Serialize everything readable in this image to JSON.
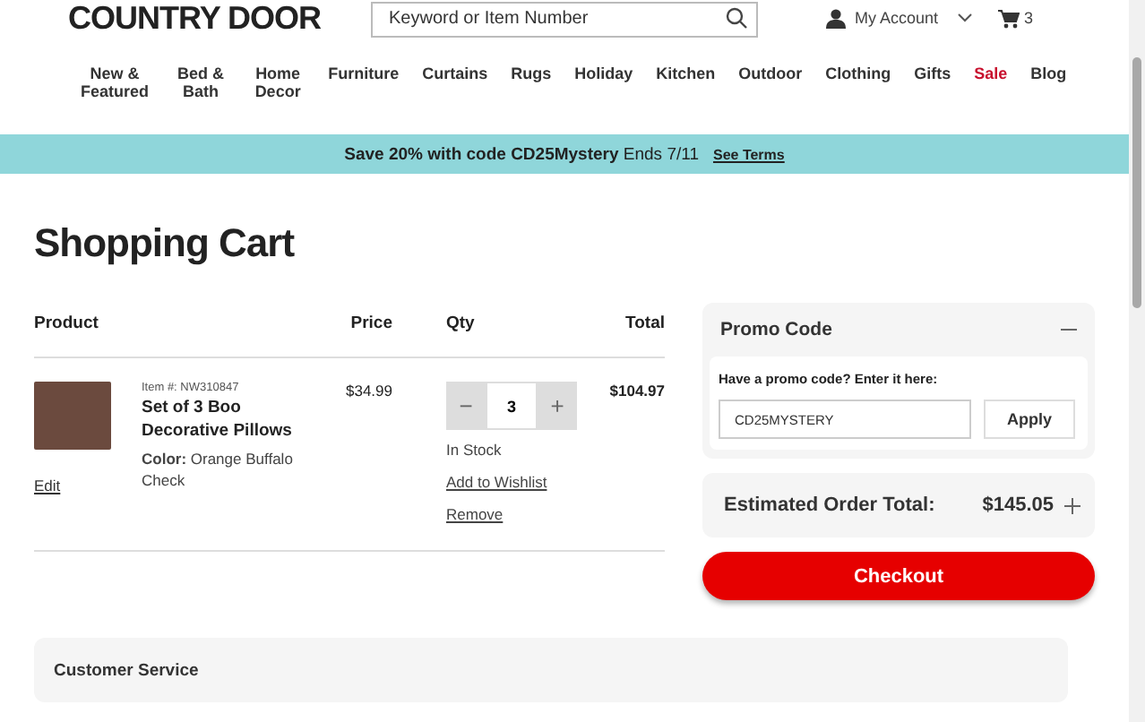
{
  "header": {
    "logo": "COUNTRY DOOR",
    "search": {
      "placeholder": "Keyword or Item Number"
    },
    "account": "My Account",
    "cart_count": "3"
  },
  "nav": [
    {
      "label": "New & Featured",
      "kind": "normal"
    },
    {
      "label": "Bed & Bath",
      "kind": "normal"
    },
    {
      "label": "Home Decor",
      "kind": "normal"
    },
    {
      "label": "Furniture",
      "kind": "normal"
    },
    {
      "label": "Curtains",
      "kind": "normal"
    },
    {
      "label": "Rugs",
      "kind": "normal"
    },
    {
      "label": "Holiday",
      "kind": "normal"
    },
    {
      "label": "Kitchen",
      "kind": "normal"
    },
    {
      "label": "Outdoor",
      "kind": "normal"
    },
    {
      "label": "Clothing",
      "kind": "normal"
    },
    {
      "label": "Gifts",
      "kind": "normal"
    },
    {
      "label": "Sale",
      "kind": "sale"
    },
    {
      "label": "Blog",
      "kind": "normal"
    }
  ],
  "banner": {
    "text": "**Save 20% with code CD25Mystery** Ends 7/11",
    "link": "See Terms"
  },
  "page_title": "Shopping Cart",
  "cart": {
    "columns": [
      "Product",
      "Price",
      "Qty",
      "Total"
    ],
    "items": [
      {
        "item_number": "Item #: NW310847",
        "name": "Set of 3 Boo Decorative Pillows",
        "edit": "Edit",
        "variant": "**Color:** Orange Buffalo Check",
        "price": "$34.99",
        "decrease": "−",
        "quantity": "3",
        "increase": "+",
        "stock": "In Stock",
        "wishlist": "Add to Wishlist",
        "remove": "Remove",
        "total": "$104.97"
      }
    ]
  },
  "promo": {
    "title": "Promo Code",
    "expanded": true,
    "prompt": "Have a promo code? Enter it here:",
    "value": "CD25MYSTERY",
    "apply": "Apply"
  },
  "summary": {
    "label": "Estimated Order Total:",
    "amount": "$145.05",
    "expanded": false
  },
  "checkout": "Checkout",
  "customer_service": {
    "title": "Customer Service"
  }
}
